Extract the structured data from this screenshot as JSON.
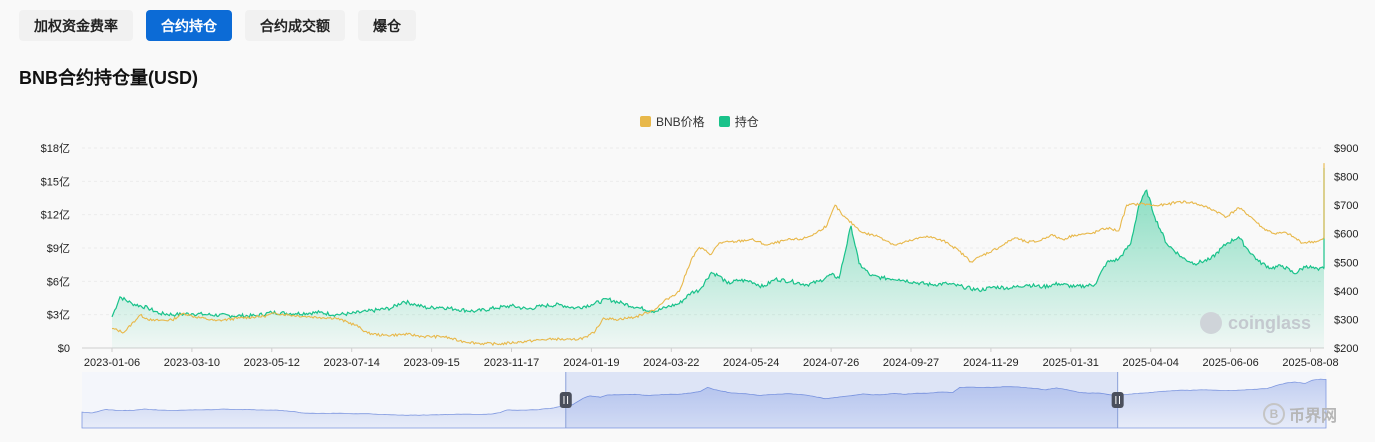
{
  "tabs": [
    {
      "label": "加权资金费率",
      "active": false
    },
    {
      "label": "合约持仓",
      "active": true
    },
    {
      "label": "合约成交额",
      "active": false
    },
    {
      "label": "爆仓",
      "active": false
    }
  ],
  "page_title": "BNB合约持仓量(USD)",
  "colors": {
    "price": "#e8b84a",
    "oi": "#19c28a",
    "active_tab": "#0c6bd6",
    "navigator": "#7f98e0"
  },
  "watermark": "coinglass",
  "corner_logo": {
    "icon": "B",
    "text": "币界网"
  },
  "chart_data": {
    "type": "line",
    "title": "",
    "legend": {
      "position": "top-center",
      "entries": [
        "BNB价格",
        "持仓"
      ]
    },
    "x_ticks": [
      "2023-01-06",
      "2023-03-10",
      "2023-05-12",
      "2023-07-14",
      "2023-09-15",
      "2023-11-17",
      "2024-01-19",
      "2024-03-22",
      "2024-05-24",
      "2024-07-26",
      "2024-09-27",
      "2024-11-29",
      "2025-01-31",
      "2025-04-04",
      "2025-06-06",
      "2025-08-08"
    ],
    "y_left": {
      "ticks": [
        "$0",
        "$3亿",
        "$6亿",
        "$9亿",
        "$12亿",
        "$15亿",
        "$18亿"
      ],
      "range": [
        0,
        18
      ],
      "unit": "亿 USD"
    },
    "y_right": {
      "ticks": [
        "$200",
        "$300",
        "$400",
        "$500",
        "$600",
        "$700",
        "$800",
        "$900"
      ],
      "range": [
        200,
        900
      ],
      "unit": "USD"
    },
    "grid": true,
    "series": [
      {
        "name": "BNB价格",
        "axis": "right",
        "style": "line",
        "points": [
          [
            0,
            268
          ],
          [
            0.15,
            255
          ],
          [
            0.35,
            315
          ],
          [
            0.5,
            296
          ],
          [
            0.75,
            298
          ],
          [
            0.9,
            322
          ],
          [
            1,
            312
          ],
          [
            1.3,
            295
          ],
          [
            1.6,
            305
          ],
          [
            1.9,
            311
          ],
          [
            2.05,
            322
          ],
          [
            2.2,
            316
          ],
          [
            2.45,
            310
          ],
          [
            2.6,
            307
          ],
          [
            2.8,
            305
          ],
          [
            3.05,
            280
          ],
          [
            3.2,
            252
          ],
          [
            3.4,
            244
          ],
          [
            3.7,
            248
          ],
          [
            3.9,
            240
          ],
          [
            4.15,
            240
          ],
          [
            4.35,
            225
          ],
          [
            4.6,
            216
          ],
          [
            4.85,
            214
          ],
          [
            5.1,
            221
          ],
          [
            5.35,
            228
          ],
          [
            5.55,
            232
          ],
          [
            5.75,
            228
          ],
          [
            5.95,
            238
          ],
          [
            6.05,
            260
          ],
          [
            6.15,
            305
          ],
          [
            6.3,
            300
          ],
          [
            6.55,
            308
          ],
          [
            6.8,
            336
          ],
          [
            6.95,
            372
          ],
          [
            7.1,
            398
          ],
          [
            7.25,
            510
          ],
          [
            7.35,
            552
          ],
          [
            7.5,
            528
          ],
          [
            7.6,
            568
          ],
          [
            7.8,
            572
          ],
          [
            8.0,
            580
          ],
          [
            8.2,
            560
          ],
          [
            8.45,
            578
          ],
          [
            8.65,
            582
          ],
          [
            8.8,
            600
          ],
          [
            8.95,
            630
          ],
          [
            9.05,
            700
          ],
          [
            9.15,
            662
          ],
          [
            9.4,
            603
          ],
          [
            9.6,
            590
          ],
          [
            9.8,
            560
          ],
          [
            10.0,
            576
          ],
          [
            10.2,
            592
          ],
          [
            10.45,
            570
          ],
          [
            10.6,
            540
          ],
          [
            10.75,
            502
          ],
          [
            10.9,
            525
          ],
          [
            11.1,
            552
          ],
          [
            11.3,
            586
          ],
          [
            11.45,
            570
          ],
          [
            11.6,
            574
          ],
          [
            11.75,
            596
          ],
          [
            11.9,
            580
          ],
          [
            12.05,
            596
          ],
          [
            12.25,
            600
          ],
          [
            12.45,
            620
          ],
          [
            12.6,
            610
          ],
          [
            12.7,
            700
          ],
          [
            12.9,
            705
          ],
          [
            13.05,
            698
          ],
          [
            13.2,
            702
          ],
          [
            13.35,
            712
          ],
          [
            13.5,
            710
          ],
          [
            13.65,
            698
          ],
          [
            13.8,
            681
          ],
          [
            13.95,
            659
          ],
          [
            14.1,
            691
          ],
          [
            14.25,
            660
          ],
          [
            14.4,
            620
          ],
          [
            14.55,
            600
          ],
          [
            14.7,
            603
          ],
          [
            14.9,
            568
          ],
          [
            15.1,
            574
          ],
          [
            15.25,
            592
          ],
          [
            15.4,
            604
          ],
          [
            15.55,
            622
          ],
          [
            15.75,
            640
          ],
          [
            15.9,
            652
          ],
          [
            16.05,
            650
          ],
          [
            16.2,
            658
          ],
          [
            16.4,
            652
          ],
          [
            16.55,
            645
          ],
          [
            16.7,
            648
          ],
          [
            16.85,
            660
          ],
          [
            17.0,
            668
          ],
          [
            17.15,
            682
          ],
          [
            17.3,
            740
          ],
          [
            17.45,
            782
          ],
          [
            17.55,
            795
          ],
          [
            17.7,
            770
          ],
          [
            17.8,
            825
          ],
          [
            17.92,
            845
          ],
          [
            18.0,
            840
          ]
        ]
      },
      {
        "name": "持仓",
        "axis": "left",
        "style": "area",
        "points": [
          [
            0,
            2.8
          ],
          [
            0.1,
            4.6
          ],
          [
            0.25,
            4.0
          ],
          [
            0.45,
            3.6
          ],
          [
            0.6,
            3.1
          ],
          [
            0.8,
            3.0
          ],
          [
            1.0,
            3.1
          ],
          [
            1.2,
            3.0
          ],
          [
            1.5,
            2.9
          ],
          [
            1.8,
            2.9
          ],
          [
            2.0,
            3.2
          ],
          [
            2.3,
            3.1
          ],
          [
            2.6,
            3.2
          ],
          [
            2.8,
            3.0
          ],
          [
            3.0,
            3.1
          ],
          [
            3.2,
            3.3
          ],
          [
            3.5,
            3.6
          ],
          [
            3.65,
            4.2
          ],
          [
            3.8,
            3.9
          ],
          [
            3.95,
            3.6
          ],
          [
            4.1,
            3.7
          ],
          [
            4.3,
            3.5
          ],
          [
            4.55,
            3.3
          ],
          [
            4.8,
            3.6
          ],
          [
            5.0,
            3.8
          ],
          [
            5.2,
            3.5
          ],
          [
            5.4,
            3.8
          ],
          [
            5.6,
            3.9
          ],
          [
            5.8,
            3.6
          ],
          [
            6.0,
            3.9
          ],
          [
            6.2,
            4.4
          ],
          [
            6.4,
            4.0
          ],
          [
            6.6,
            3.6
          ],
          [
            6.8,
            3.3
          ],
          [
            6.95,
            3.7
          ],
          [
            7.1,
            4.0
          ],
          [
            7.25,
            5.0
          ],
          [
            7.35,
            5.2
          ],
          [
            7.5,
            6.8
          ],
          [
            7.6,
            6.5
          ],
          [
            7.7,
            5.8
          ],
          [
            7.85,
            6.1
          ],
          [
            8.0,
            6.0
          ],
          [
            8.15,
            5.5
          ],
          [
            8.3,
            6.2
          ],
          [
            8.5,
            6.0
          ],
          [
            8.7,
            5.7
          ],
          [
            8.85,
            6.0
          ],
          [
            9.0,
            6.6
          ],
          [
            9.1,
            6.3
          ],
          [
            9.25,
            11.0
          ],
          [
            9.35,
            7.6
          ],
          [
            9.5,
            6.5
          ],
          [
            9.65,
            6.3
          ],
          [
            9.85,
            6.2
          ],
          [
            10.05,
            5.9
          ],
          [
            10.25,
            5.7
          ],
          [
            10.45,
            5.8
          ],
          [
            10.65,
            5.5
          ],
          [
            10.85,
            5.2
          ],
          [
            11.05,
            5.5
          ],
          [
            11.25,
            5.4
          ],
          [
            11.45,
            5.7
          ],
          [
            11.65,
            5.5
          ],
          [
            11.85,
            5.8
          ],
          [
            12.05,
            5.5
          ],
          [
            12.3,
            5.7
          ],
          [
            12.45,
            7.7
          ],
          [
            12.6,
            8.0
          ],
          [
            12.75,
            9.4
          ],
          [
            12.85,
            12.8
          ],
          [
            12.95,
            14.2
          ],
          [
            13.05,
            11.8
          ],
          [
            13.2,
            9.4
          ],
          [
            13.4,
            8.1
          ],
          [
            13.55,
            7.6
          ],
          [
            13.75,
            8.0
          ],
          [
            13.95,
            9.4
          ],
          [
            14.1,
            10.0
          ],
          [
            14.2,
            9.0
          ],
          [
            14.35,
            7.8
          ],
          [
            14.5,
            7.2
          ],
          [
            14.65,
            7.4
          ],
          [
            14.8,
            6.7
          ],
          [
            14.95,
            7.4
          ],
          [
            15.1,
            7.0
          ],
          [
            15.25,
            7.6
          ],
          [
            15.4,
            8.3
          ],
          [
            15.55,
            7.8
          ],
          [
            15.7,
            8.3
          ],
          [
            15.85,
            7.6
          ],
          [
            16.0,
            7.9
          ],
          [
            16.15,
            7.7
          ],
          [
            16.3,
            8.2
          ],
          [
            16.5,
            7.6
          ],
          [
            16.65,
            7.3
          ],
          [
            16.8,
            7.5
          ],
          [
            17.0,
            7.4
          ],
          [
            17.15,
            7.9
          ],
          [
            17.3,
            9.0
          ],
          [
            17.42,
            12.6
          ],
          [
            17.52,
            16.2
          ],
          [
            17.6,
            12.0
          ],
          [
            17.7,
            14.2
          ],
          [
            17.8,
            12.8
          ],
          [
            17.9,
            13.8
          ],
          [
            18.0,
            15.6
          ]
        ]
      }
    ],
    "navigator": {
      "selected_range_ticks": [
        "2024-03-22",
        "2025-08-08"
      ]
    }
  }
}
